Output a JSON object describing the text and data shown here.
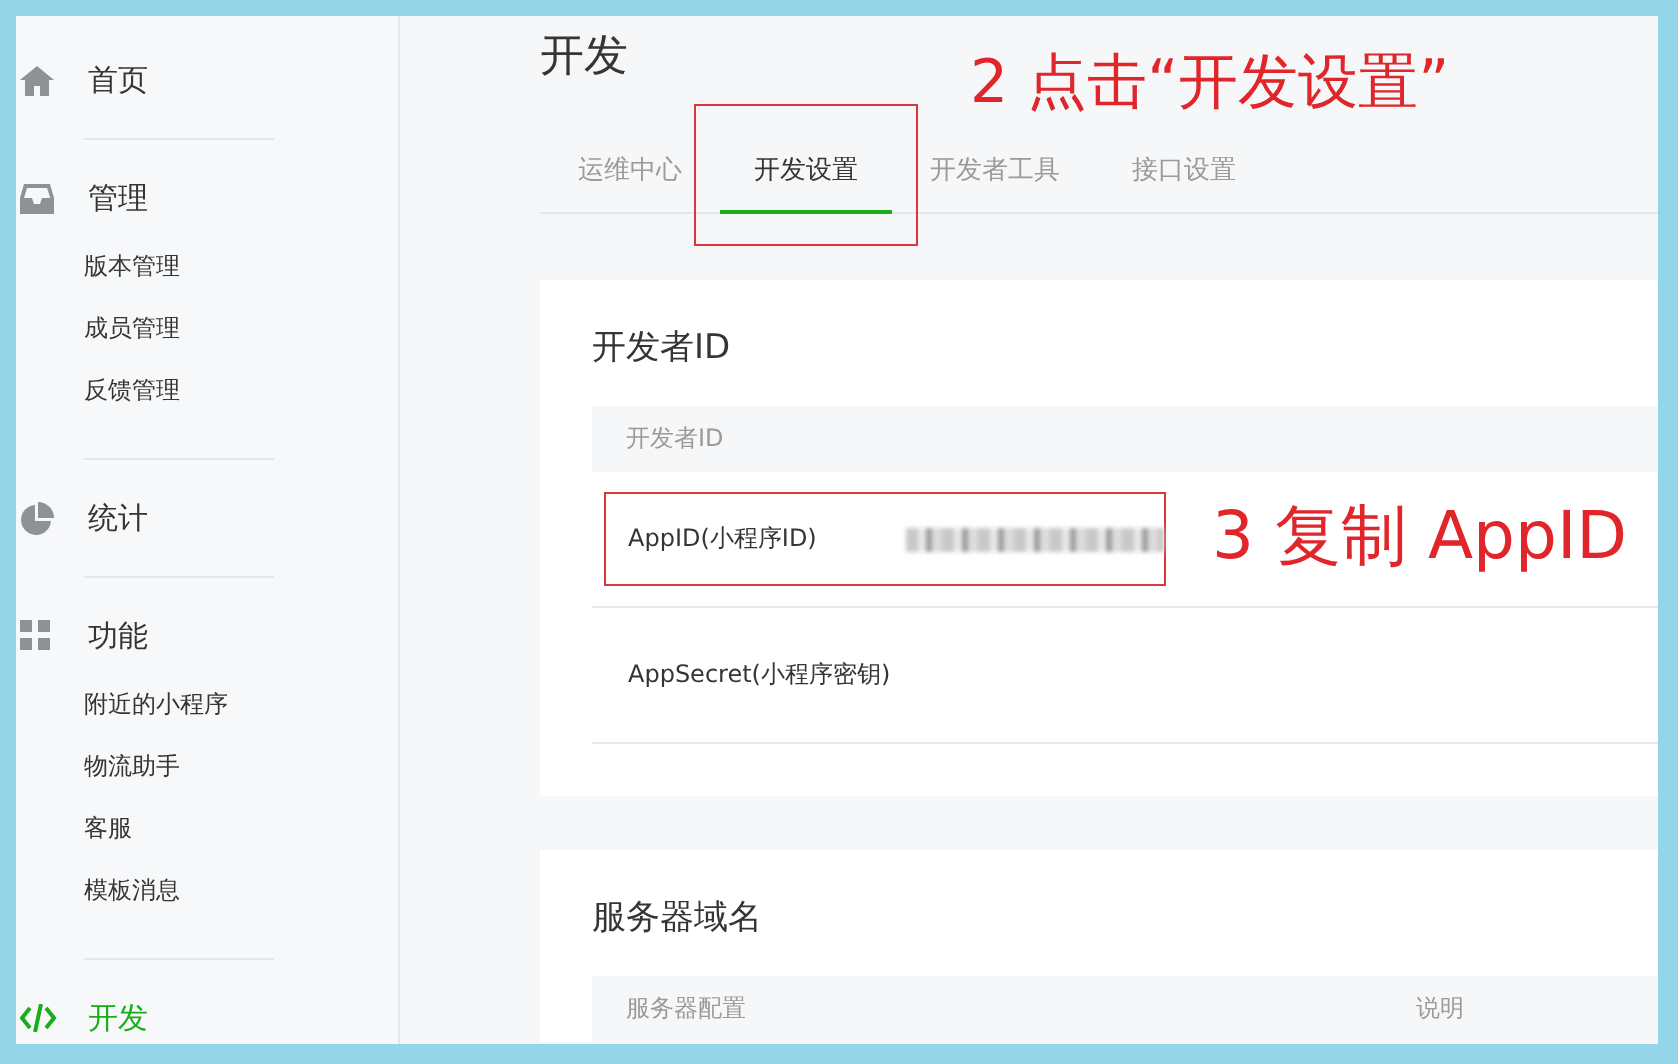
{
  "sidebar": {
    "items": [
      {
        "label": "首页",
        "selected": false
      },
      {
        "label": "管理",
        "selected": false,
        "children": [
          {
            "label": "版本管理",
            "selected": false
          },
          {
            "label": "成员管理",
            "selected": false
          },
          {
            "label": "反馈管理",
            "selected": false
          }
        ]
      },
      {
        "label": "统计",
        "selected": false
      },
      {
        "label": "功能",
        "selected": false,
        "children": [
          {
            "label": "附近的小程序",
            "selected": false
          },
          {
            "label": "物流助手",
            "selected": false
          },
          {
            "label": "客服",
            "selected": false
          },
          {
            "label": "模板消息",
            "selected": false
          }
        ]
      },
      {
        "label": "开发",
        "selected": true
      }
    ]
  },
  "page": {
    "title": "开发",
    "tabs": [
      {
        "label": "运维中心",
        "selected": false,
        "outlined": false
      },
      {
        "label": "开发设置",
        "selected": true,
        "outlined": true
      },
      {
        "label": "开发者工具",
        "selected": false,
        "outlined": false
      },
      {
        "label": "接口设置",
        "selected": false,
        "outlined": false
      }
    ],
    "tab_annotation": "2 点击“开发设置”",
    "cards": [
      {
        "title": "开发者ID",
        "columns": [
          "开发者ID"
        ],
        "rows": [
          {
            "label": "AppID(小程序ID)",
            "kind": "masked",
            "outlined": true,
            "annotation": "3 复制 AppID"
          },
          {
            "label": "AppSecret(小程序密钥)",
            "kind": "empty",
            "outlined": false
          }
        ]
      },
      {
        "title": "服务器域名",
        "columns": [
          "服务器配置",
          "说明"
        ]
      }
    ]
  }
}
